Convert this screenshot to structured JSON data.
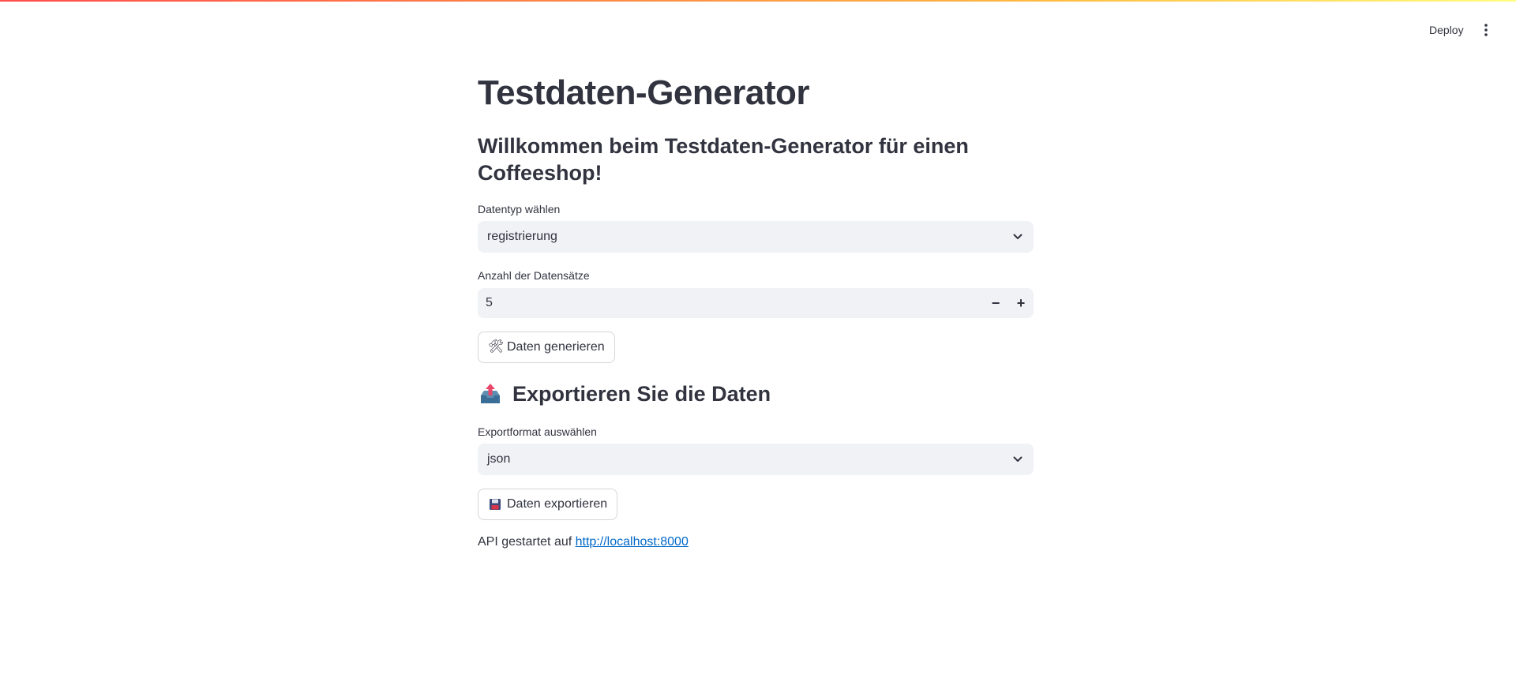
{
  "header": {
    "deploy_label": "Deploy",
    "menu_icon": "more-vertical-icon"
  },
  "main": {
    "title": "Testdaten-Generator",
    "welcome": "Willkommen beim Testdaten-Generator für einen Coffeeshop!",
    "datatype": {
      "label": "Datentyp wählen",
      "value": "registrierung"
    },
    "count": {
      "label": "Anzahl der Datensätze",
      "value": "5",
      "minus": "−",
      "plus": "+"
    },
    "generate_button": {
      "icon": "hammer-wrench-icon",
      "label": "Daten generieren"
    },
    "export": {
      "icon": "outbox-tray-icon",
      "heading": "Exportieren Sie die Daten",
      "format_label": "Exportformat auswählen",
      "format_value": "json"
    },
    "export_button": {
      "icon": "floppy-disk-icon",
      "label": "Daten exportieren"
    },
    "api": {
      "text": "API gestartet auf",
      "link": "http://localhost:8000"
    }
  },
  "colors": {
    "accent_red": "#ff4b4b",
    "link": "#0068c9",
    "input_bg": "#f0f2f6",
    "text": "#31333f"
  }
}
